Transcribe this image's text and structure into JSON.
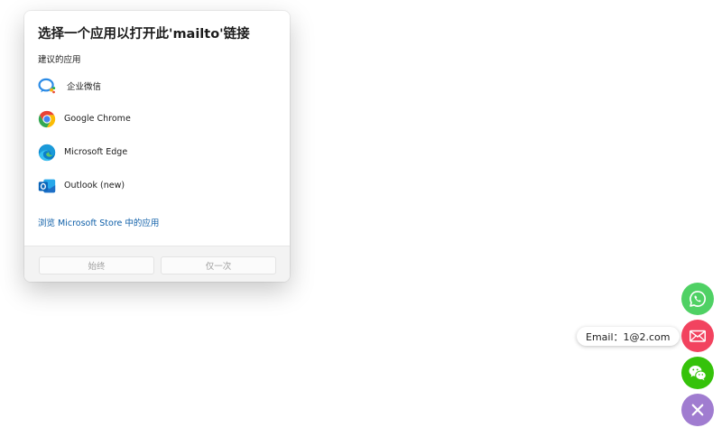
{
  "dialog": {
    "title": "选择一个应用以打开此'mailto'链接",
    "section_label": "建议的应用",
    "apps": [
      {
        "label": "企业微信",
        "icon": "wecom-icon"
      },
      {
        "label": "Google Chrome",
        "icon": "chrome-icon"
      },
      {
        "label": "Microsoft Edge",
        "icon": "edge-icon"
      },
      {
        "label": "Outlook (new)",
        "icon": "outlook-icon"
      }
    ],
    "store_link": "浏览 Microsoft Store 中的应用",
    "buttons": {
      "always": "始终",
      "once": "仅一次"
    }
  },
  "contact": {
    "email_tooltip": "Email：1@2.com",
    "buttons": [
      {
        "icon": "whatsapp-icon",
        "color": "#4fd164"
      },
      {
        "icon": "email-icon",
        "color": "#f2435f"
      },
      {
        "icon": "wechat-icon",
        "color": "#35c20a"
      },
      {
        "icon": "close-icon",
        "color": "#a07cd0"
      }
    ]
  }
}
